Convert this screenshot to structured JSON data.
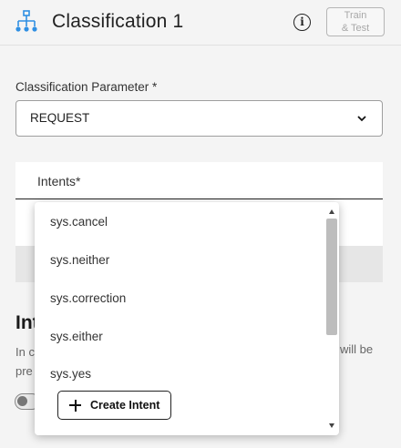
{
  "header": {
    "title": "Classification 1",
    "info_icon": "i",
    "train_button": {
      "line1": "Train",
      "line2": "& Test"
    }
  },
  "parameter": {
    "label": "Classification Parameter *",
    "value": "REQUEST"
  },
  "intents": {
    "label": "Intents*"
  },
  "section": {
    "title": "Int",
    "text_line1": "In c",
    "text_line2": "pre",
    "text_right": "will be"
  },
  "dropdown": {
    "options": [
      "sys.cancel",
      "sys.neither",
      "sys.correction",
      "sys.either",
      "sys.yes"
    ],
    "create_label": "Create Intent"
  },
  "icons": {
    "header": "tree-structure-icon",
    "info": "info-icon",
    "chevron": "chevron-down-icon",
    "plus": "plus-icon"
  },
  "colors": {
    "accent": "#2f8fe3",
    "background": "#f4f4f4",
    "disabled_text": "#a8a8a8"
  }
}
